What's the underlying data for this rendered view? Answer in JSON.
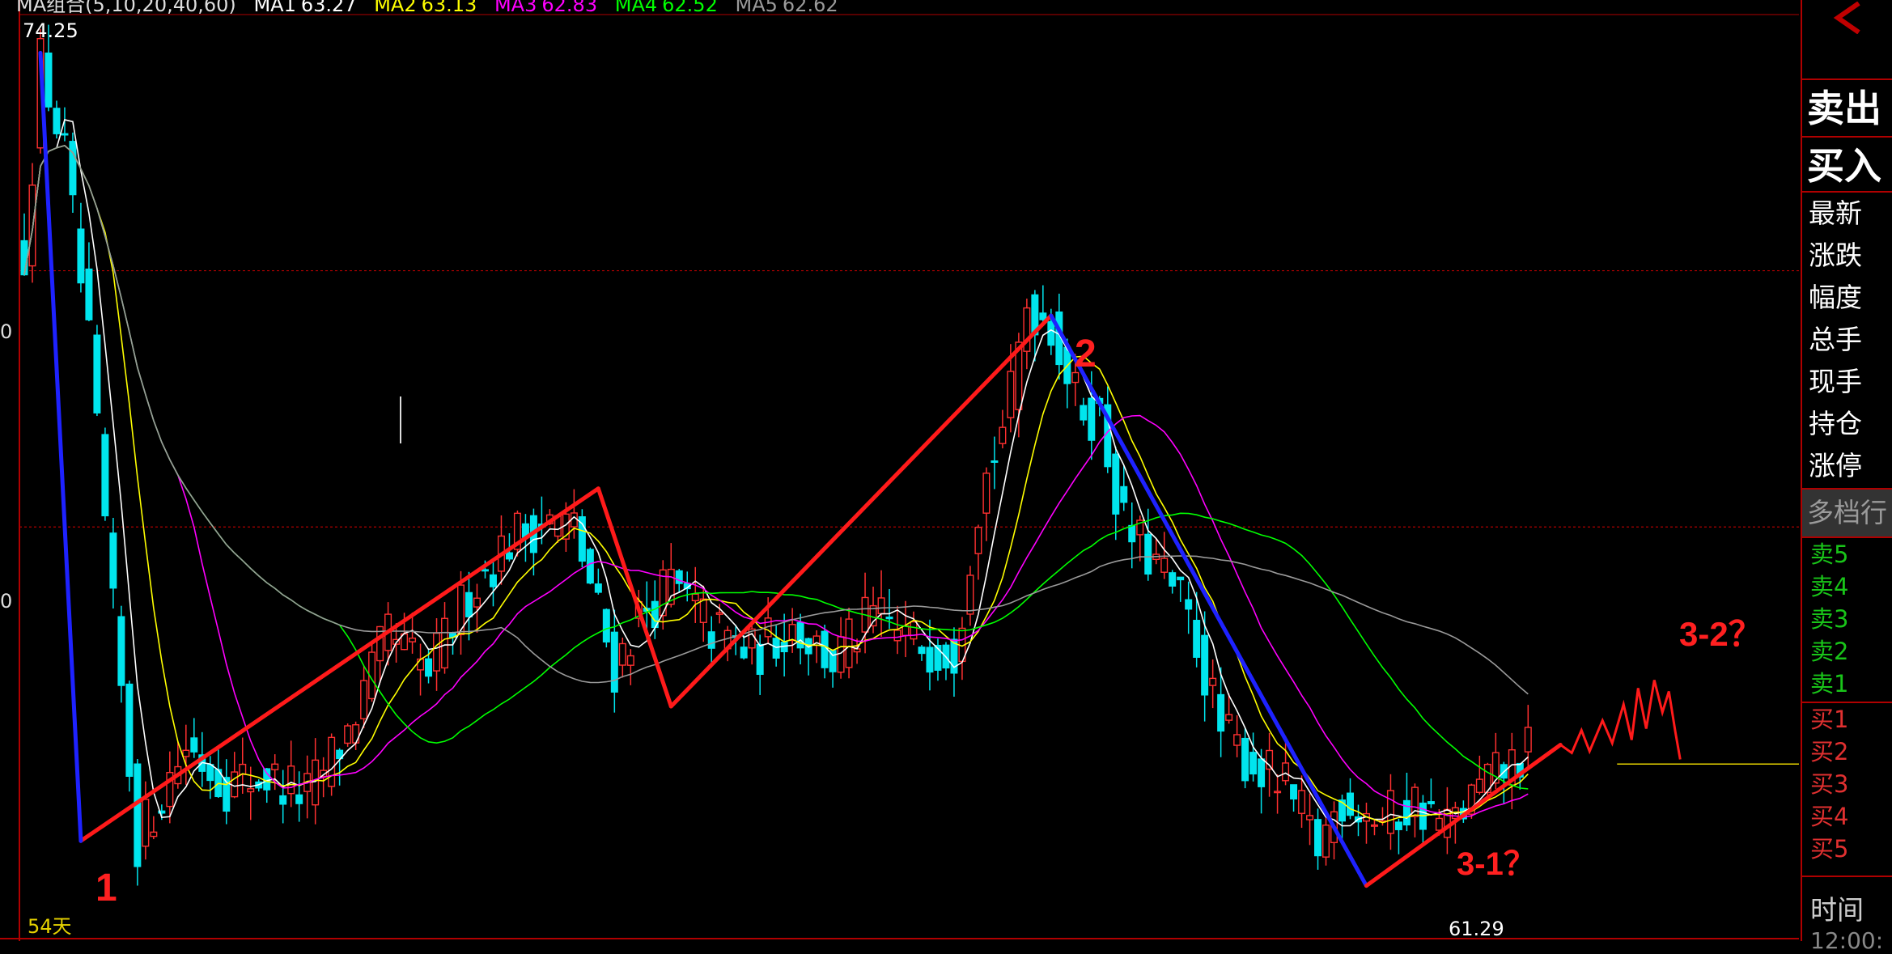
{
  "chart_data": {
    "type": "candlestick",
    "indicator_legend": {
      "main": "MA组合(5,10,20,40,60)",
      "items": [
        {
          "name": "MA1",
          "value": "63.27",
          "color": "#ffffff"
        },
        {
          "name": "MA2",
          "value": "63.13",
          "color": "#ffff00"
        },
        {
          "name": "MA3",
          "value": "62.83",
          "color": "#ff00ff"
        },
        {
          "name": "MA4",
          "value": "62.52",
          "color": "#00ff00"
        },
        {
          "name": "MA5",
          "value": "62.62",
          "color": "#9a9a9a"
        }
      ]
    },
    "high_label": "74.25",
    "low_label": "61.29",
    "days_label": "54天",
    "ylim": [
      60.6,
      75.2
    ],
    "reference_lines": [
      71,
      67
    ],
    "left_tick_labels": [
      "0",
      "0"
    ],
    "colors": {
      "up": "#ff3030",
      "down": "#00e5ee",
      "wave_red": "#ff1a1a",
      "wave_blue": "#1e22ff"
    },
    "price_path": [
      [
        0,
        71.3
      ],
      [
        2,
        74.25
      ],
      [
        5,
        72.8
      ],
      [
        8,
        69.8
      ],
      [
        11,
        65.6
      ],
      [
        14,
        62.1
      ],
      [
        20,
        63.6
      ],
      [
        25,
        63.0
      ],
      [
        30,
        63.1
      ],
      [
        35,
        62.8
      ],
      [
        40,
        63.8
      ],
      [
        45,
        65.3
      ],
      [
        50,
        64.7
      ],
      [
        55,
        66.0
      ],
      [
        60,
        66.8
      ],
      [
        64,
        67.1
      ],
      [
        68,
        67.0
      ],
      [
        70,
        66.1
      ],
      [
        73,
        64.8
      ],
      [
        76,
        65.6
      ],
      [
        80,
        66.1
      ],
      [
        85,
        65.4
      ],
      [
        90,
        65.0
      ],
      [
        95,
        65.5
      ],
      [
        100,
        64.9
      ],
      [
        105,
        65.6
      ],
      [
        110,
        65.2
      ],
      [
        115,
        65.1
      ],
      [
        118,
        67.4
      ],
      [
        122,
        69.0
      ],
      [
        124,
        70.5
      ],
      [
        127,
        70.2
      ],
      [
        130,
        69.0
      ],
      [
        133,
        68.7
      ],
      [
        136,
        67.0
      ],
      [
        140,
        66.4
      ],
      [
        143,
        65.8
      ],
      [
        145,
        65.2
      ],
      [
        148,
        63.8
      ],
      [
        152,
        63.3
      ],
      [
        156,
        62.9
      ],
      [
        160,
        62.0
      ],
      [
        163,
        62.8
      ],
      [
        168,
        62.4
      ],
      [
        172,
        62.7
      ],
      [
        176,
        62.3
      ],
      [
        180,
        62.9
      ],
      [
        183,
        63.2
      ],
      [
        186,
        63.5
      ]
    ],
    "wave_points": {
      "red_up_1": [
        [
          7,
          62.1
        ],
        [
          71,
          67.6
        ]
      ],
      "red_down_1": [
        [
          71,
          67.6
        ],
        [
          80,
          64.2
        ]
      ],
      "red_up_2": [
        [
          80,
          64.2
        ],
        [
          127,
          70.3
        ]
      ],
      "blue_down_1": [
        [
          2,
          74.4
        ],
        [
          7,
          62.1
        ]
      ],
      "blue_down_2": [
        [
          127,
          70.3
        ],
        [
          166,
          61.4
        ]
      ],
      "red_up_3": [
        [
          166,
          61.4
        ],
        [
          190,
          63.6
        ]
      ]
    },
    "annotations": [
      "1",
      "2",
      "3-1？",
      "3-2？"
    ]
  },
  "panel": {
    "sell_button": "卖出",
    "buy_button": "买入",
    "stats": [
      "最新",
      "涨跌",
      "幅度",
      "总手",
      "现手",
      "持仓",
      "涨停"
    ],
    "multi_tab": "多档行",
    "sell_levels": [
      "卖5",
      "卖4",
      "卖3",
      "卖2",
      "卖1"
    ],
    "buy_levels": [
      "买1",
      "买2",
      "买3",
      "买4",
      "买5"
    ],
    "time_label": "时间",
    "time_value": "12:00:"
  }
}
